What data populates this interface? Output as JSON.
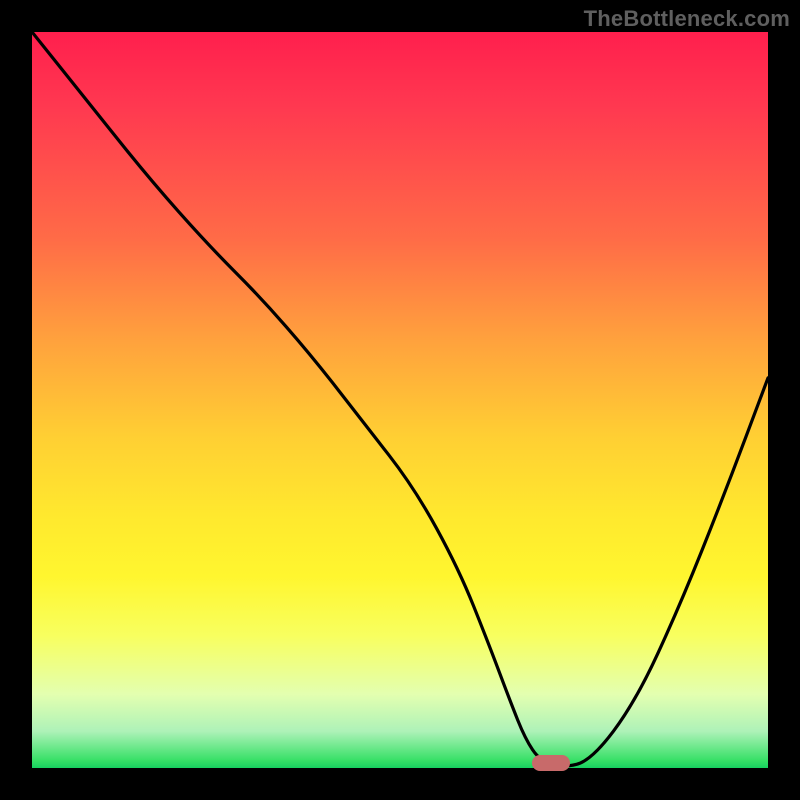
{
  "watermark": "TheBottleneck.com",
  "chart_data": {
    "type": "line",
    "title": "",
    "xlabel": "",
    "ylabel": "",
    "xlim": [
      0,
      100
    ],
    "ylim": [
      0,
      100
    ],
    "series": [
      {
        "name": "curve",
        "x": [
          0,
          8,
          16,
          24,
          31,
          38,
          45,
          52,
          58,
          62,
          65,
          67,
          69,
          72,
          76,
          82,
          88,
          94,
          100
        ],
        "values": [
          100,
          90,
          80,
          71,
          64,
          56,
          47,
          38,
          27,
          17,
          9,
          4,
          1,
          0,
          1,
          9,
          22,
          37,
          53
        ]
      }
    ],
    "marker": {
      "x": 70.5,
      "y": 0.7
    },
    "gradient_stops": [
      {
        "pct": 0,
        "color": "#ff1f4d"
      },
      {
        "pct": 50,
        "color": "#ffd733"
      },
      {
        "pct": 100,
        "color": "#17d060"
      }
    ]
  }
}
